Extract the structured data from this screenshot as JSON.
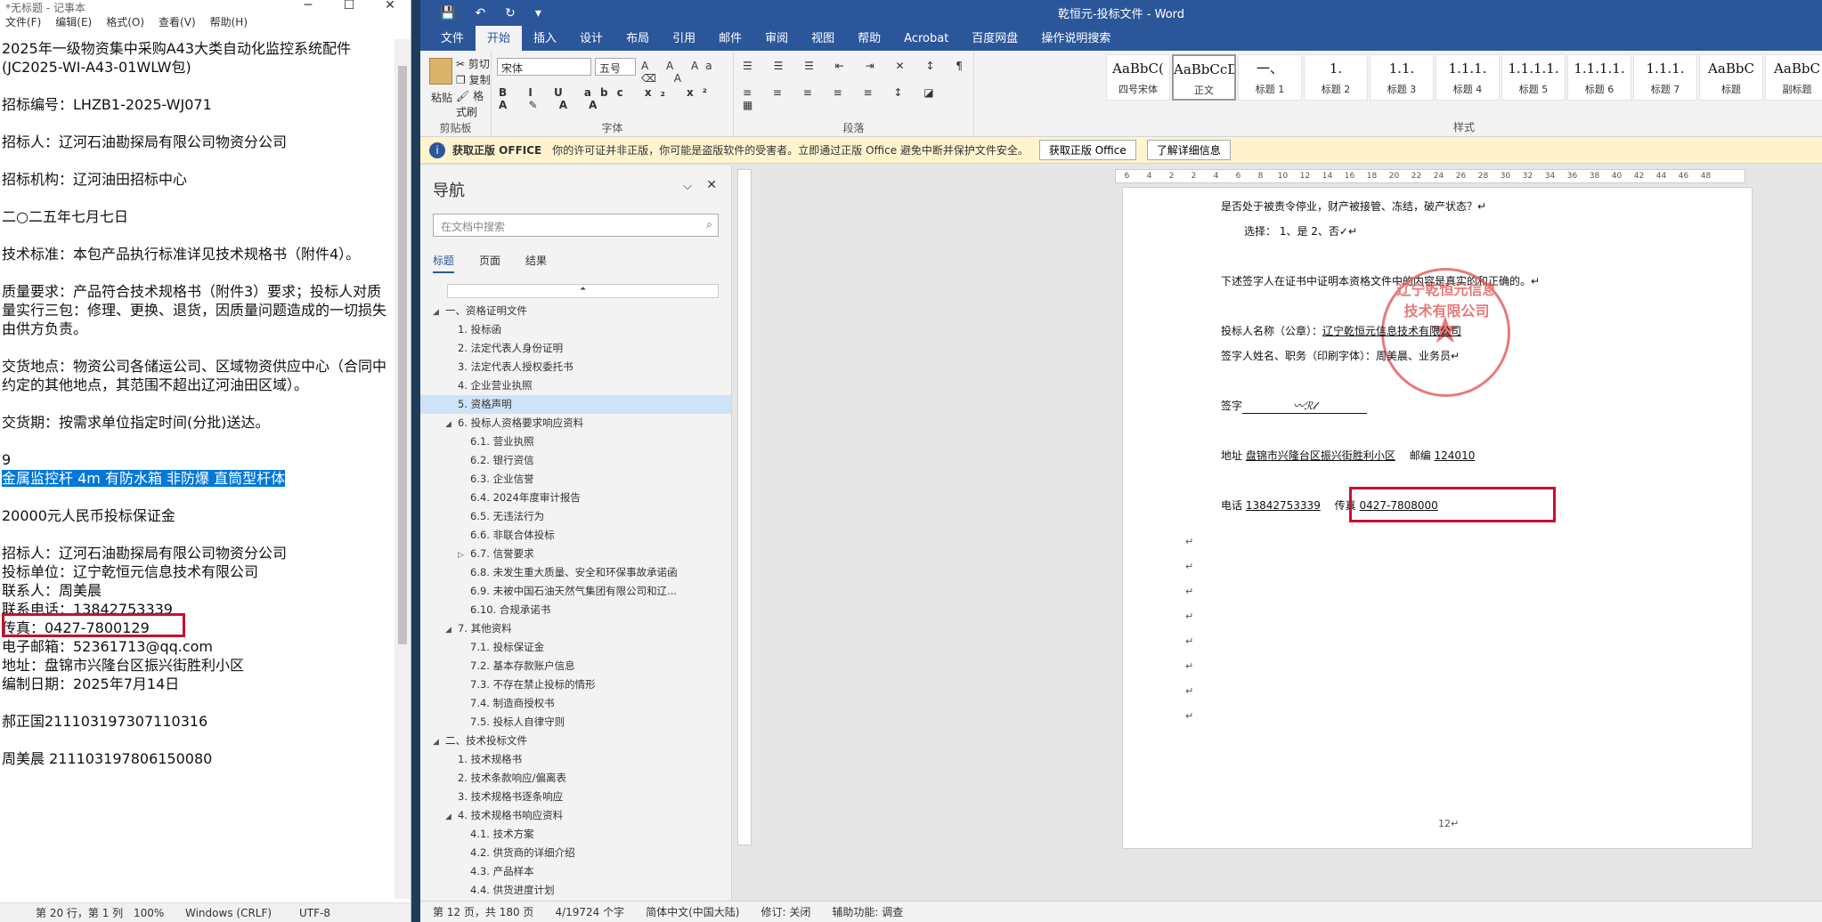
{
  "notepad": {
    "title": "*无标题 - 记事本",
    "menu": [
      "文件(F)",
      "编辑(E)",
      "格式(O)",
      "查看(V)",
      "帮助(H)"
    ],
    "lines": [
      "2025年一级物资集中采购A43大类自动化监控系统配件",
      "(JC2025-WI-A43-01WLW包)",
      "",
      "招标编号：LHZB1-2025-WJ071",
      "",
      "招标人：辽河石油勘探局有限公司物资分公司",
      "",
      "招标机构：辽河油田招标中心",
      "",
      "二○二五年七月七日",
      "",
      "技术标准：本包产品执行标准详见技术规格书（附件4）。",
      "",
      "质量要求：产品符合技术规格书（附件3）要求；投标人对质",
      "量实行三包：修理、更换、退货，因质量问题造成的一切损失",
      "由供方负责。",
      "",
      "交货地点：物资公司各储运公司、区域物资供应中心（合同中",
      "约定的其他地点，其范围不超出辽河油田区域）。",
      "",
      "交货期：按需求单位指定时间(分批)送达。",
      "",
      "9",
      "金属监控杆 4m 有防水箱 非防爆 直筒型杆体",
      "",
      "20000元人民币投标保证金",
      "",
      "招标人：辽河石油勘探局有限公司物资分公司",
      "投标单位：辽宁乾恒元信息技术有限公司",
      "联系人：周美晨",
      "联系电话：13842753339",
      "传真：0427-7800129",
      "电子邮箱：52361713@qq.com",
      "地址：盘锦市兴隆台区振兴街胜利小区",
      "编制日期：2025年7月14日",
      "",
      "郝正国211103197307110316",
      "",
      "周美晨 211103197806150080"
    ],
    "status": {
      "pos": "第 20 行，第 1 列",
      "zoom": "100%",
      "eol": "Windows (CRLF)",
      "enc": "UTF-8"
    }
  },
  "word": {
    "title": "乾恒元-投标文件 - Word",
    "tabs": [
      "文件",
      "开始",
      "插入",
      "设计",
      "布局",
      "引用",
      "邮件",
      "审阅",
      "视图",
      "帮助",
      "Acrobat",
      "百度网盘",
      "操作说明搜索"
    ],
    "clipboard": {
      "paste": "粘贴",
      "cut": "剪切",
      "copy": "复制",
      "painter": "格式刷",
      "label": "剪贴板"
    },
    "font": {
      "name": "宋体",
      "size": "五号",
      "label": "字体"
    },
    "paragraph_label": "段落",
    "styles_label": "样式",
    "styles": [
      {
        "pv": "AaBbC(",
        "nm": "四号宋体"
      },
      {
        "pv": "AaBbCcDdI",
        "nm": "正文"
      },
      {
        "pv": "一、",
        "nm": "标题 1"
      },
      {
        "pv": "1.",
        "nm": "标题 2"
      },
      {
        "pv": "1.1.",
        "nm": "标题 3"
      },
      {
        "pv": "1.1.1.",
        "nm": "标题 4"
      },
      {
        "pv": "1.1.1.1.",
        "nm": "标题 5"
      },
      {
        "pv": "1.1.1.1.",
        "nm": "标题 6"
      },
      {
        "pv": "1.1.1.",
        "nm": "标题 7"
      },
      {
        "pv": "AaBbC",
        "nm": "标题"
      },
      {
        "pv": "AaBbC",
        "nm": "副标题"
      }
    ],
    "info": {
      "title": "获取正版 OFFICE",
      "msg": "你的许可证并非正版，你可能是盗版软件的受害者。立即通过正版 Office 避免中断并保护文件安全。",
      "btn1": "获取正版 Office",
      "btn2": "了解详细信息"
    },
    "nav": {
      "title": "导航",
      "search": "在文档中搜索",
      "tabs": [
        "标题",
        "页面",
        "结果"
      ],
      "items": [
        {
          "t": "一、资格证明文件",
          "l": 0,
          "a": "◢"
        },
        {
          "t": "1. 投标函",
          "l": 1,
          "a": ""
        },
        {
          "t": "2. 法定代表人身份证明",
          "l": 1,
          "a": ""
        },
        {
          "t": "3. 法定代表人授权委托书",
          "l": 1,
          "a": ""
        },
        {
          "t": "4. 企业营业执照",
          "l": 1,
          "a": ""
        },
        {
          "t": "5. 资格声明",
          "l": 1,
          "a": "",
          "hl": true
        },
        {
          "t": "6. 投标人资格要求响应资料",
          "l": 1,
          "a": "◢"
        },
        {
          "t": "6.1. 营业执照",
          "l": 2,
          "a": ""
        },
        {
          "t": "6.2. 银行资信",
          "l": 2,
          "a": ""
        },
        {
          "t": "6.3. 企业信誉",
          "l": 2,
          "a": ""
        },
        {
          "t": "6.4. 2024年度审计报告",
          "l": 2,
          "a": ""
        },
        {
          "t": "6.5. 无违法行为",
          "l": 2,
          "a": ""
        },
        {
          "t": "6.6. 非联合体投标",
          "l": 2,
          "a": ""
        },
        {
          "t": "6.7. 信誉要求",
          "l": 2,
          "a": "▷"
        },
        {
          "t": "6.8. 未发生重大质量、安全和环保事故承诺函",
          "l": 2,
          "a": ""
        },
        {
          "t": "6.9. 未被中国石油天然气集团有限公司和辽...",
          "l": 2,
          "a": ""
        },
        {
          "t": "6.10. 合规承诺书",
          "l": 2,
          "a": ""
        },
        {
          "t": "7. 其他资料",
          "l": 1,
          "a": "◢"
        },
        {
          "t": "7.1. 投标保证金",
          "l": 2,
          "a": ""
        },
        {
          "t": "7.2. 基本存款账户信息",
          "l": 2,
          "a": ""
        },
        {
          "t": "7.3. 不存在禁止投标的情形",
          "l": 2,
          "a": ""
        },
        {
          "t": "7.4. 制造商授权书",
          "l": 2,
          "a": ""
        },
        {
          "t": "7.5. 投标人自律守则",
          "l": 2,
          "a": ""
        },
        {
          "t": "二、技术投标文件",
          "l": 0,
          "a": "◢"
        },
        {
          "t": "1. 技术规格书",
          "l": 1,
          "a": ""
        },
        {
          "t": "2. 技术条款响应/偏离表",
          "l": 1,
          "a": ""
        },
        {
          "t": "3. 技术规格书逐条响应",
          "l": 1,
          "a": ""
        },
        {
          "t": "4. 技术规格书响应资料",
          "l": 1,
          "a": "◢"
        },
        {
          "t": "4.1. 技术方案",
          "l": 2,
          "a": ""
        },
        {
          "t": "4.2. 供货商的详细介绍",
          "l": 2,
          "a": ""
        },
        {
          "t": "4.3. 产品样本",
          "l": 2,
          "a": ""
        },
        {
          "t": "4.4. 供货进度计划",
          "l": 2,
          "a": ""
        }
      ]
    },
    "doc": {
      "l1": "是否处于被责令停业，财产被接管、冻结，破产状态？↵",
      "l2": "选择：  1、是          2、否✓↵",
      "l3": "下述签字人在证书中证明本资格文件中的内容是真实的和正确的。↵",
      "l4a": "投标人名称（公章）：",
      "l4b": "辽宁乾恒元信息技术有限公司",
      "l5": "签字人姓名、职务（印刷字体）：周美晨、业务员↵",
      "l6": "签字",
      "l7a": "地址",
      "l7b": "盘锦市兴隆台区振兴街胜利小区",
      "l7c": "邮编",
      "l7d": "124010",
      "l8a": "电话",
      "l8b": "13842753339",
      "l8c": "传真",
      "l8d": "0427-7808000",
      "seal": "辽宁乾恒元信息技术有限公司",
      "pagenum": "12↵"
    },
    "status": [
      "第 12 页，共 180 页",
      "4/19724 个字",
      "简体中文(中国大陆)",
      "修订: 关闭",
      "辅助功能: 调查"
    ]
  }
}
